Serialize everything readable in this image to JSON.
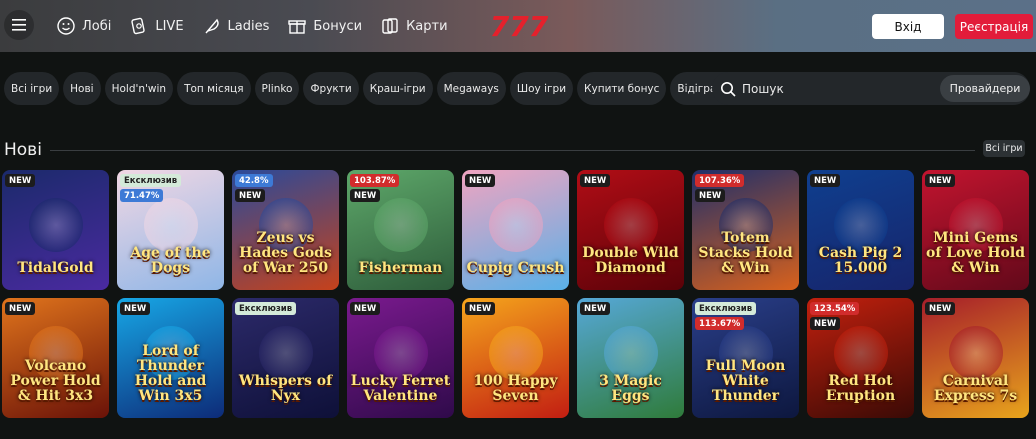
{
  "header": {
    "nav": [
      {
        "label": "Лобі",
        "icon": "smiley-icon"
      },
      {
        "label": "LIVE",
        "icon": "cards-icon"
      },
      {
        "label": "Ladies",
        "icon": "feather-icon"
      },
      {
        "label": "Бонуси",
        "icon": "gift-icon"
      },
      {
        "label": "Карти",
        "icon": "playing-cards-icon"
      }
    ],
    "logo": "777",
    "login_label": "Вхід",
    "register_label": "Реєстрація"
  },
  "filters": [
    "Всі ігри",
    "Нові",
    "Hold'n'win",
    "Топ місяця",
    "Plinko",
    "Фрукти",
    "Краш-ігри",
    "Megaways",
    "Шоу ігри",
    "Купити бонус",
    "Відіграш бонусів"
  ],
  "search": {
    "placeholder": "Пошук",
    "providers_label": "Провайдери"
  },
  "section": {
    "title": "Нові",
    "see_all_label": "Всі ігри"
  },
  "games": [
    {
      "title": "TidalGold",
      "badges": [
        {
          "type": "new",
          "text": "NEW"
        }
      ],
      "colors": [
        "#1b2a6b",
        "#4a2aa0"
      ]
    },
    {
      "title": "Age of the Dogs",
      "badges": [
        {
          "type": "excl",
          "text": "Ексклюзив"
        },
        {
          "type": "pct",
          "text": "71.47%"
        }
      ],
      "colors": [
        "#f1d7e4",
        "#8fb6e6"
      ]
    },
    {
      "title": "Zeus vs Hades Gods of War 250",
      "badges": [
        {
          "type": "pct",
          "text": "42.8%"
        },
        {
          "type": "new",
          "text": "NEW"
        }
      ],
      "colors": [
        "#2a4a9a",
        "#c6421b"
      ]
    },
    {
      "title": "Fisherman",
      "badges": [
        {
          "type": "pct-red",
          "text": "103.87%"
        },
        {
          "type": "new",
          "text": "NEW"
        }
      ],
      "colors": [
        "#5ea86a",
        "#2d5b3a"
      ]
    },
    {
      "title": "Cupig Crush",
      "badges": [
        {
          "type": "new",
          "text": "NEW"
        }
      ],
      "colors": [
        "#f0a4c0",
        "#59b0e8"
      ]
    },
    {
      "title": "Double Wild Diamond",
      "badges": [
        {
          "type": "new",
          "text": "NEW"
        }
      ],
      "colors": [
        "#b10d16",
        "#5a0208"
      ]
    },
    {
      "title": "Totem Stacks Hold & Win",
      "badges": [
        {
          "type": "pct-red",
          "text": "107.36%"
        },
        {
          "type": "new",
          "text": "NEW"
        }
      ],
      "colors": [
        "#1f2f6a",
        "#d8611c"
      ]
    },
    {
      "title": "Cash Pig 2 15.000",
      "badges": [
        {
          "type": "new",
          "text": "NEW"
        }
      ],
      "colors": [
        "#0f3f8f",
        "#17246a"
      ]
    },
    {
      "title": "Mini Gems of Love Hold & Win",
      "badges": [
        {
          "type": "new",
          "text": "NEW"
        }
      ],
      "colors": [
        "#c2142f",
        "#62091a"
      ]
    },
    {
      "title": "Volcano Power Hold & Hit 3x3",
      "badges": [
        {
          "type": "new",
          "text": "NEW"
        }
      ],
      "colors": [
        "#e0741c",
        "#6a1208"
      ]
    },
    {
      "title": "Lord of Thunder Hold and Win 3x5",
      "badges": [
        {
          "type": "new",
          "text": "NEW"
        }
      ],
      "colors": [
        "#17a7e6",
        "#0d2b78"
      ]
    },
    {
      "title": "Whispers of Nyx",
      "badges": [
        {
          "type": "excl",
          "text": "Ексклюзив"
        }
      ],
      "colors": [
        "#2c2a6a",
        "#0e1038"
      ]
    },
    {
      "title": "Lucky Ferret Valentine",
      "badges": [
        {
          "type": "new",
          "text": "NEW"
        }
      ],
      "colors": [
        "#7a1a8e",
        "#2f0a4a"
      ]
    },
    {
      "title": "100 Happy Seven",
      "badges": [
        {
          "type": "new",
          "text": "NEW"
        }
      ],
      "colors": [
        "#f5a51c",
        "#c21e12"
      ]
    },
    {
      "title": "3 Magic Eggs",
      "badges": [
        {
          "type": "new",
          "text": "NEW"
        }
      ],
      "colors": [
        "#56a8d8",
        "#2f7b3a"
      ]
    },
    {
      "title": "Full Moon White Thunder",
      "badges": [
        {
          "type": "excl",
          "text": "Ексклюзив"
        },
        {
          "type": "pct-red",
          "text": "113.67%"
        }
      ],
      "colors": [
        "#2a3f8a",
        "#0d173e"
      ]
    },
    {
      "title": "Red Hot Eruption",
      "badges": [
        {
          "type": "pct-red",
          "text": "123.54%"
        },
        {
          "type": "new",
          "text": "NEW"
        }
      ],
      "colors": [
        "#c2200e",
        "#3a0a05"
      ]
    },
    {
      "title": "Carnival Express 7s",
      "badges": [
        {
          "type": "new",
          "text": "NEW"
        }
      ],
      "colors": [
        "#a61e2a",
        "#e8a41c"
      ]
    }
  ]
}
